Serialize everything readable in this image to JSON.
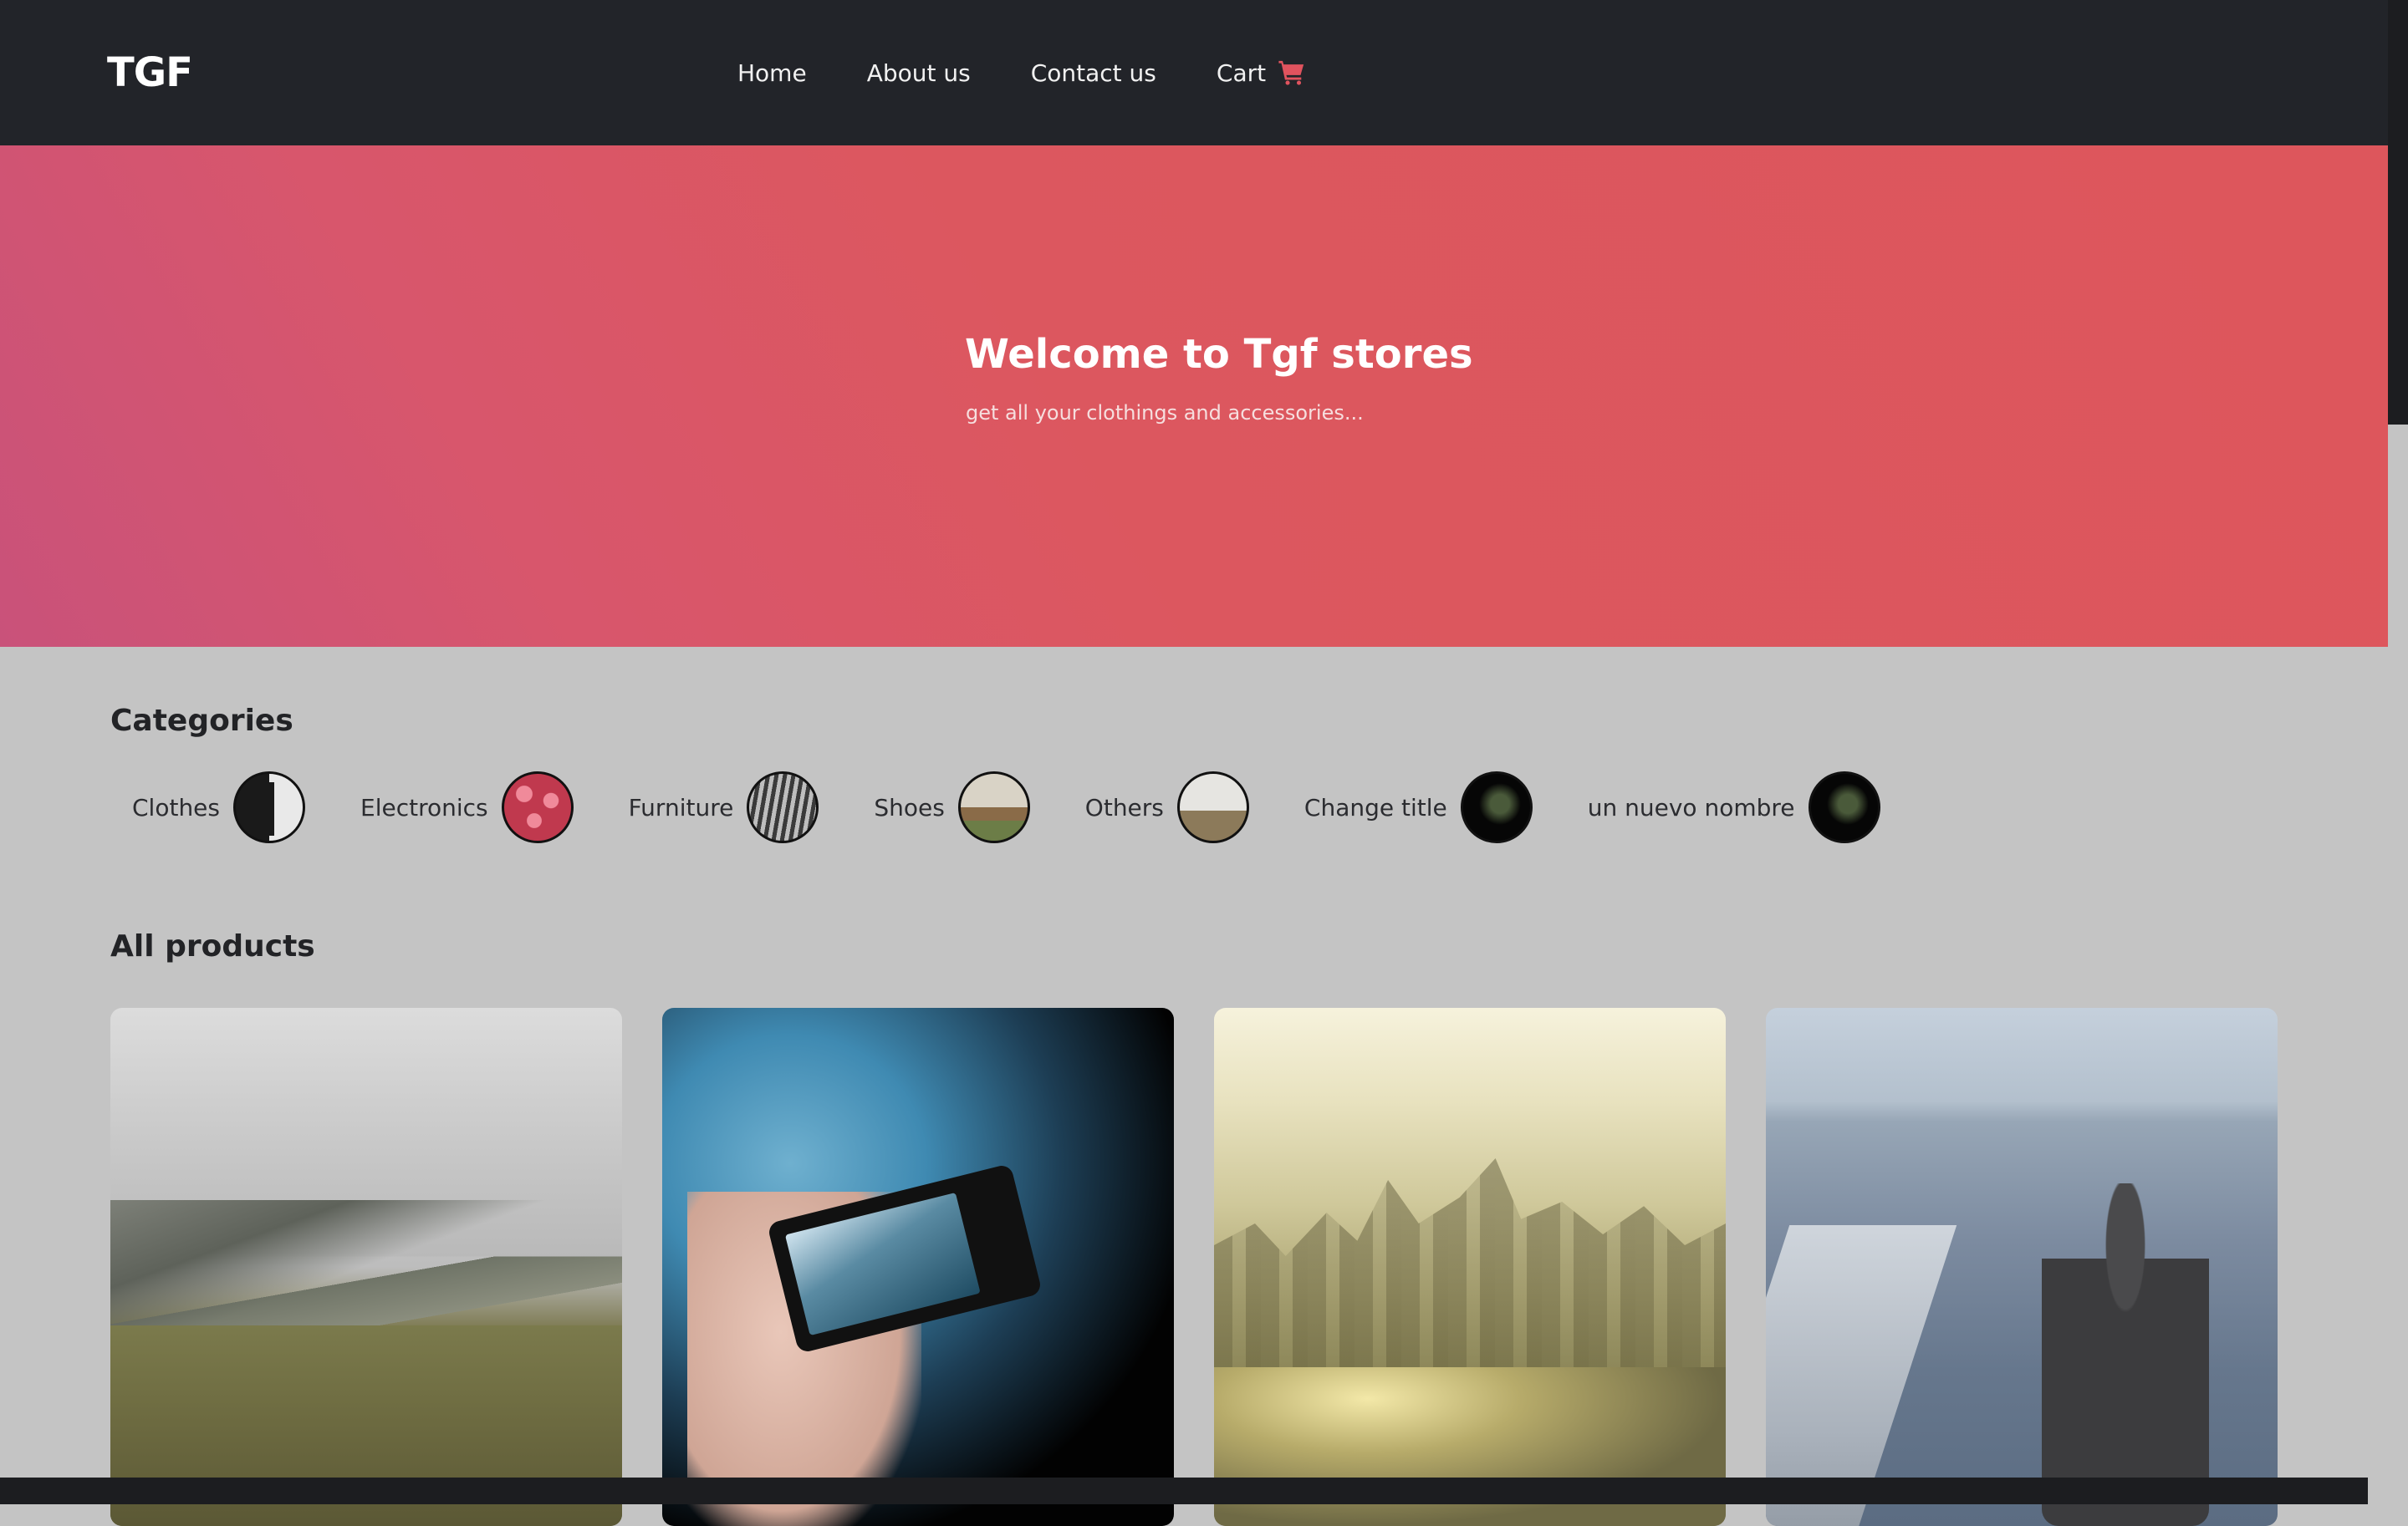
{
  "navbar": {
    "brand": "TGF",
    "links": [
      {
        "label": "Home"
      },
      {
        "label": "About us"
      },
      {
        "label": "Contact us"
      },
      {
        "label": "Cart",
        "icon": "cart-icon"
      }
    ]
  },
  "hero": {
    "title": "Welcome to Tgf stores",
    "subtitle": "get all your clothings and accessories..."
  },
  "categories": {
    "heading": "Categories",
    "items": [
      {
        "label": "Clothes"
      },
      {
        "label": "Electronics"
      },
      {
        "label": "Furniture"
      },
      {
        "label": "Shoes"
      },
      {
        "label": "Others"
      },
      {
        "label": "Change title"
      },
      {
        "label": "un nuevo nombre"
      }
    ]
  },
  "products": {
    "heading": "All products"
  },
  "colors": {
    "navbar": "#222429",
    "hero_accent": "#dd565c",
    "page_background": "#c4c4c4",
    "cart_icon": "#e0535e"
  }
}
